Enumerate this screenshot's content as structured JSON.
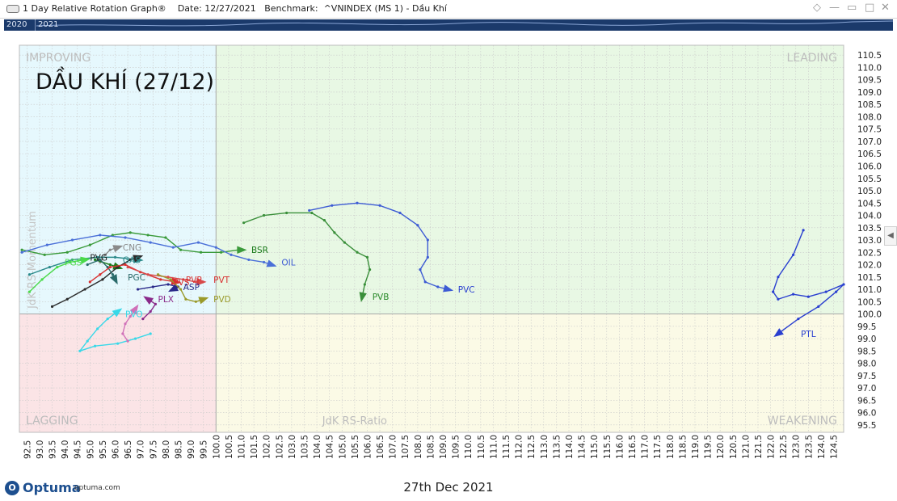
{
  "window": {
    "title": "1 Day Relative Rotation Graph®",
    "date_label": "Date: 12/27/2021",
    "benchmark_label": "Benchmark:  ^VNINDEX (MS 1) - Dầu Khí"
  },
  "timeline": {
    "years": [
      "2020",
      "2021"
    ]
  },
  "footer": {
    "date": "27th Dec 2021",
    "logo": "Optuma",
    "url": "optuma.com"
  },
  "colors": {
    "improving": "#e6f8fd",
    "leading": "#e8f8e4",
    "weakening": "#fbfae6",
    "lagging": "#fbe4e6"
  },
  "chart_data": {
    "type": "scatter",
    "title": "DẦU KHÍ (27/12)",
    "xlabel": "JdK RS-Ratio",
    "ylabel": "JdK RS-Momentum",
    "xlim": [
      92.2,
      124.9
    ],
    "ylim": [
      95.2,
      110.9
    ],
    "center": [
      100.0,
      100.0
    ],
    "grid": true,
    "quadrants": [
      "IMPROVING",
      "LEADING",
      "WEAKENING",
      "LAGGING"
    ],
    "x_ticks": [
      92.5,
      93.0,
      93.5,
      94.0,
      94.5,
      95.0,
      95.5,
      96.0,
      96.5,
      97.0,
      97.5,
      98.0,
      98.5,
      99.0,
      99.5,
      100.0,
      100.5,
      101.0,
      101.5,
      102.0,
      102.5,
      103.0,
      103.5,
      104.0,
      104.5,
      105.0,
      105.5,
      106.0,
      106.5,
      107.0,
      107.5,
      108.0,
      108.5,
      109.0,
      109.5,
      110.0,
      110.5,
      111.0,
      111.5,
      112.0,
      112.5,
      113.0,
      113.5,
      114.0,
      114.5,
      115.0,
      115.5,
      116.0,
      116.5,
      117.0,
      117.5,
      118.0,
      118.5,
      119.0,
      119.5,
      120.0,
      120.5,
      121.0,
      121.5,
      122.0,
      122.5,
      123.0,
      123.5,
      124.0,
      124.5
    ],
    "y_ticks": [
      95.5,
      96.0,
      96.5,
      97.0,
      97.5,
      98.0,
      98.5,
      99.0,
      99.5,
      100.0,
      100.5,
      101.0,
      101.5,
      102.0,
      102.5,
      103.0,
      103.5,
      104.0,
      104.5,
      105.0,
      105.5,
      106.0,
      106.5,
      107.0,
      107.5,
      108.0,
      108.5,
      109.0,
      109.5,
      110.0,
      110.5
    ],
    "series": [
      {
        "name": "PVC",
        "color": "#3d5bd4",
        "points": [
          [
            103.7,
            104.2
          ],
          [
            104.6,
            104.4
          ],
          [
            105.6,
            104.5
          ],
          [
            106.5,
            104.4
          ],
          [
            107.3,
            104.1
          ],
          [
            108.0,
            103.6
          ],
          [
            108.4,
            103.0
          ],
          [
            108.4,
            102.3
          ],
          [
            108.1,
            101.8
          ],
          [
            108.3,
            101.3
          ],
          [
            108.8,
            101.1
          ],
          [
            109.2,
            101.0
          ]
        ]
      },
      {
        "name": "PVB",
        "color": "#3a8f3a",
        "points": [
          [
            101.1,
            103.7
          ],
          [
            101.9,
            104.0
          ],
          [
            102.8,
            104.1
          ],
          [
            103.8,
            104.1
          ],
          [
            104.3,
            103.8
          ],
          [
            104.7,
            103.3
          ],
          [
            105.1,
            102.9
          ],
          [
            105.6,
            102.5
          ],
          [
            106.0,
            102.3
          ],
          [
            106.1,
            101.8
          ],
          [
            105.9,
            101.2
          ],
          [
            105.8,
            100.7
          ]
        ]
      },
      {
        "name": "BSR",
        "color": "#3a9a3a",
        "points": [
          [
            92.3,
            102.6
          ],
          [
            93.2,
            102.4
          ],
          [
            94.1,
            102.5
          ],
          [
            95.0,
            102.8
          ],
          [
            95.9,
            103.2
          ],
          [
            96.6,
            103.3
          ],
          [
            97.3,
            103.2
          ],
          [
            98.0,
            103.1
          ],
          [
            98.6,
            102.6
          ],
          [
            99.4,
            102.5
          ],
          [
            100.2,
            102.5
          ],
          [
            100.9,
            102.6
          ],
          [
            101.0,
            102.6
          ]
        ]
      },
      {
        "name": "OIL",
        "color": "#4a6fd8",
        "points": [
          [
            92.3,
            102.5
          ],
          [
            93.3,
            102.8
          ],
          [
            94.3,
            103.0
          ],
          [
            95.4,
            103.2
          ],
          [
            96.4,
            103.1
          ],
          [
            97.4,
            102.9
          ],
          [
            98.3,
            102.7
          ],
          [
            99.3,
            102.9
          ],
          [
            100.0,
            102.7
          ],
          [
            100.6,
            102.4
          ],
          [
            101.3,
            102.2
          ],
          [
            101.9,
            102.1
          ],
          [
            102.2,
            102.0
          ]
        ]
      },
      {
        "name": "PTL",
        "color": "#2a3fd0",
        "points": [
          [
            123.3,
            103.4
          ],
          [
            122.9,
            102.4
          ],
          [
            122.3,
            101.5
          ],
          [
            122.1,
            100.9
          ],
          [
            122.3,
            100.6
          ],
          [
            122.9,
            100.8
          ],
          [
            123.5,
            100.7
          ],
          [
            124.2,
            100.9
          ],
          [
            124.9,
            101.2
          ],
          [
            124.6,
            100.9
          ],
          [
            123.9,
            100.3
          ],
          [
            123.1,
            99.8
          ],
          [
            122.3,
            99.2
          ]
        ]
      },
      {
        "name": "CNG",
        "color": "#8a8a8a",
        "points": [
          [
            95.4,
            102.1
          ],
          [
            95.6,
            102.4
          ],
          [
            95.8,
            102.6
          ],
          [
            96.1,
            102.7
          ]
        ]
      },
      {
        "name": "PVG",
        "color": "#1a7a1a",
        "points": [
          [
            95.2,
            102.2
          ],
          [
            95.8,
            102.0
          ],
          [
            96.1,
            101.9
          ]
        ]
      },
      {
        "name": "GAS",
        "color": "#2a8a8a",
        "points": [
          [
            92.6,
            101.6
          ],
          [
            93.4,
            101.9
          ],
          [
            94.3,
            102.2
          ],
          [
            95.3,
            102.3
          ],
          [
            96.0,
            102.3
          ],
          [
            96.9,
            102.2
          ]
        ]
      },
      {
        "name": "PGS",
        "color": "#4ada4a",
        "points": [
          [
            92.6,
            100.9
          ],
          [
            93.1,
            101.4
          ],
          [
            93.7,
            101.9
          ],
          [
            94.2,
            102.1
          ],
          [
            94.8,
            102.2
          ]
        ]
      },
      {
        "name": "BSR_trail",
        "color": "#2a2a2a",
        "points": [
          [
            93.5,
            100.3
          ],
          [
            94.1,
            100.6
          ],
          [
            94.8,
            101.0
          ],
          [
            95.5,
            101.4
          ],
          [
            96.1,
            101.9
          ],
          [
            96.6,
            102.2
          ],
          [
            96.9,
            102.3
          ]
        ]
      },
      {
        "name": "PGC",
        "color": "#2a6a6a",
        "points": [
          [
            94.9,
            102.0
          ],
          [
            95.4,
            102.2
          ],
          [
            95.7,
            101.9
          ],
          [
            95.9,
            101.6
          ],
          [
            96.0,
            101.4
          ]
        ]
      },
      {
        "name": "PVS",
        "color": "#d83030",
        "points": [
          [
            95.0,
            101.3
          ],
          [
            95.4,
            101.6
          ],
          [
            95.8,
            101.9
          ],
          [
            96.4,
            102.0
          ],
          [
            97.0,
            101.7
          ],
          [
            97.8,
            101.4
          ],
          [
            98.4,
            101.3
          ]
        ]
      },
      {
        "name": "PVT",
        "color": "#d84a4a",
        "points": [
          [
            96.5,
            101.9
          ],
          [
            97.3,
            101.6
          ],
          [
            98.1,
            101.5
          ],
          [
            98.7,
            101.4
          ],
          [
            99.2,
            101.3
          ],
          [
            99.4,
            101.3
          ]
        ]
      },
      {
        "name": "ASP",
        "color": "#2a2a8a",
        "points": [
          [
            96.9,
            101.0
          ],
          [
            97.5,
            101.1
          ],
          [
            98.1,
            101.2
          ],
          [
            98.5,
            101.1
          ],
          [
            98.3,
            101.0
          ]
        ]
      },
      {
        "name": "PVD",
        "color": "#9a9a2a",
        "points": [
          [
            97.7,
            101.6
          ],
          [
            98.2,
            101.4
          ],
          [
            98.6,
            101.0
          ],
          [
            98.8,
            100.6
          ],
          [
            99.2,
            100.5
          ],
          [
            99.5,
            100.6
          ]
        ]
      },
      {
        "name": "PLX",
        "color": "#8a2a8a",
        "points": [
          [
            97.1,
            99.8
          ],
          [
            97.4,
            100.1
          ],
          [
            97.6,
            100.4
          ],
          [
            97.3,
            100.6
          ]
        ]
      },
      {
        "name": "PVO",
        "color": "#38d8e8",
        "points": [
          [
            97.4,
            99.2
          ],
          [
            96.8,
            99.0
          ],
          [
            96.1,
            98.8
          ],
          [
            95.2,
            98.7
          ],
          [
            94.6,
            98.5
          ],
          [
            94.9,
            98.9
          ],
          [
            95.3,
            99.4
          ],
          [
            95.7,
            99.8
          ],
          [
            96.1,
            100.1
          ]
        ]
      },
      {
        "name": "PVO_b",
        "color": "#d070b8",
        "points": [
          [
            96.5,
            98.9
          ],
          [
            96.3,
            99.2
          ],
          [
            96.4,
            99.6
          ],
          [
            96.6,
            99.9
          ],
          [
            96.8,
            100.2
          ]
        ]
      }
    ],
    "labels": [
      {
        "name": "PVC",
        "x": 109.6,
        "y": 101.0,
        "color": "#2a3fd0"
      },
      {
        "name": "PVB",
        "x": 106.2,
        "y": 100.7,
        "color": "#2a8a2a"
      },
      {
        "name": "BSR",
        "x": 101.4,
        "y": 102.6,
        "color": "#1a7a1a"
      },
      {
        "name": "OIL",
        "x": 102.6,
        "y": 102.1,
        "color": "#3d5bd4"
      },
      {
        "name": "PTL",
        "x": 123.2,
        "y": 99.2,
        "color": "#2a3fd0"
      },
      {
        "name": "CNG",
        "x": 96.3,
        "y": 102.7,
        "color": "#8a8a8a"
      },
      {
        "name": "PVG",
        "x": 95.0,
        "y": 102.3,
        "color": "#1a1a1a"
      },
      {
        "name": "GAS",
        "x": 96.3,
        "y": 102.2,
        "color": "#2a8a8a"
      },
      {
        "name": "PGS",
        "x": 94.0,
        "y": 102.1,
        "color": "#4ada4a"
      },
      {
        "name": "PGC",
        "x": 96.5,
        "y": 101.5,
        "color": "#2a6a6a"
      },
      {
        "name": "PVS",
        "x": 98.3,
        "y": 101.3,
        "color": "#d83030"
      },
      {
        "name": "PVP",
        "x": 98.8,
        "y": 101.4,
        "color": "#d83030"
      },
      {
        "name": "PVT",
        "x": 99.9,
        "y": 101.4,
        "color": "#d83030"
      },
      {
        "name": "ASP",
        "x": 98.7,
        "y": 101.1,
        "color": "#2a2a8a"
      },
      {
        "name": "PVD",
        "x": 99.9,
        "y": 100.6,
        "color": "#9a9a2a"
      },
      {
        "name": "PLX",
        "x": 97.7,
        "y": 100.6,
        "color": "#8a2a8a"
      },
      {
        "name": "PVO",
        "x": 96.4,
        "y": 100.0,
        "color": "#38d8e8"
      }
    ]
  }
}
